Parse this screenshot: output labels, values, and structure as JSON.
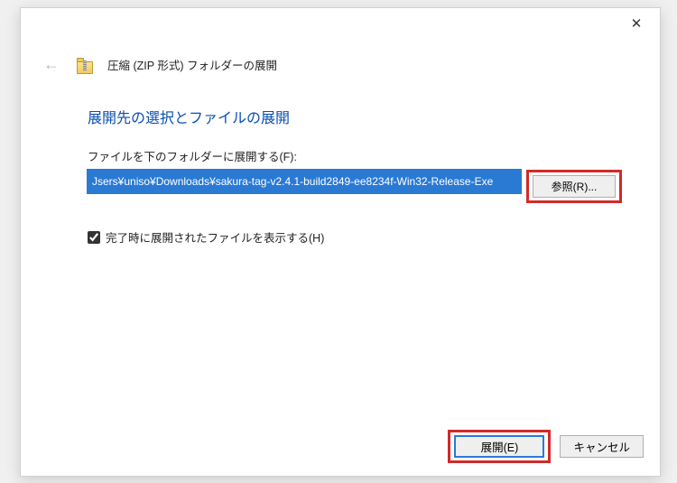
{
  "titlebar": {
    "close": "✕"
  },
  "header": {
    "back": "←",
    "dialog_title": "圧縮 (ZIP 形式) フォルダーの展開"
  },
  "content": {
    "heading": "展開先の選択とファイルの展開",
    "folder_label": "ファイルを下のフォルダーに展開する(F):",
    "folder_path": "Jsers¥uniso¥Downloads¥sakura-tag-v2.4.1-build2849-ee8234f-Win32-Release-Exe",
    "browse_label": "参照(R)...",
    "show_files_label": "完了時に展開されたファイルを表示する(H)",
    "show_files_checked": true
  },
  "footer": {
    "extract_label": "展開(E)",
    "cancel_label": "キャンセル"
  },
  "colors": {
    "accent_blue": "#2a7ad4",
    "heading_blue": "#0a4fb3",
    "highlight_red": "#d12a2a"
  }
}
